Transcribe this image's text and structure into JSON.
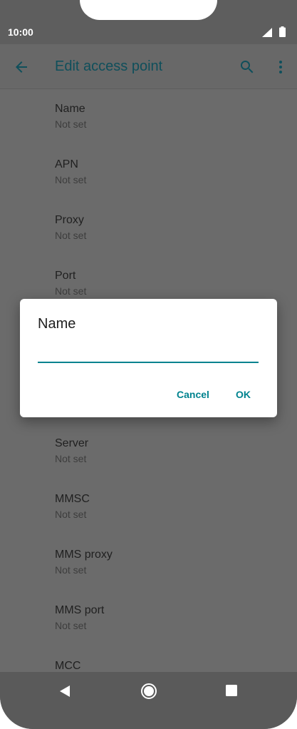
{
  "status_bar": {
    "time": "10:00",
    "icons": [
      "signal-icon",
      "battery-icon"
    ]
  },
  "app_bar": {
    "title": "Edit access point",
    "icons": [
      "back-arrow-icon",
      "search-icon",
      "more-vert-icon"
    ]
  },
  "list": {
    "items": [
      {
        "title": "Name",
        "value": "Not set"
      },
      {
        "title": "APN",
        "value": "Not set"
      },
      {
        "title": "Proxy",
        "value": "Not set"
      },
      {
        "title": "Port",
        "value": "Not set"
      },
      {
        "title": "Server",
        "value": "Not set"
      },
      {
        "title": "MMSC",
        "value": "Not set"
      },
      {
        "title": "MMS proxy",
        "value": "Not set"
      },
      {
        "title": "MMS port",
        "value": "Not set"
      },
      {
        "title": "MCC",
        "value": ""
      }
    ]
  },
  "dialog": {
    "title": "Name",
    "input_value": "",
    "cancel_label": "Cancel",
    "ok_label": "OK"
  },
  "nav_bar": {
    "icons": [
      "nav-back-icon",
      "nav-home-icon",
      "nav-recents-icon"
    ]
  },
  "colors": {
    "accent": "#00838f",
    "scrim_background": "#6b6b6b",
    "title_color": "#0f4f5b"
  }
}
